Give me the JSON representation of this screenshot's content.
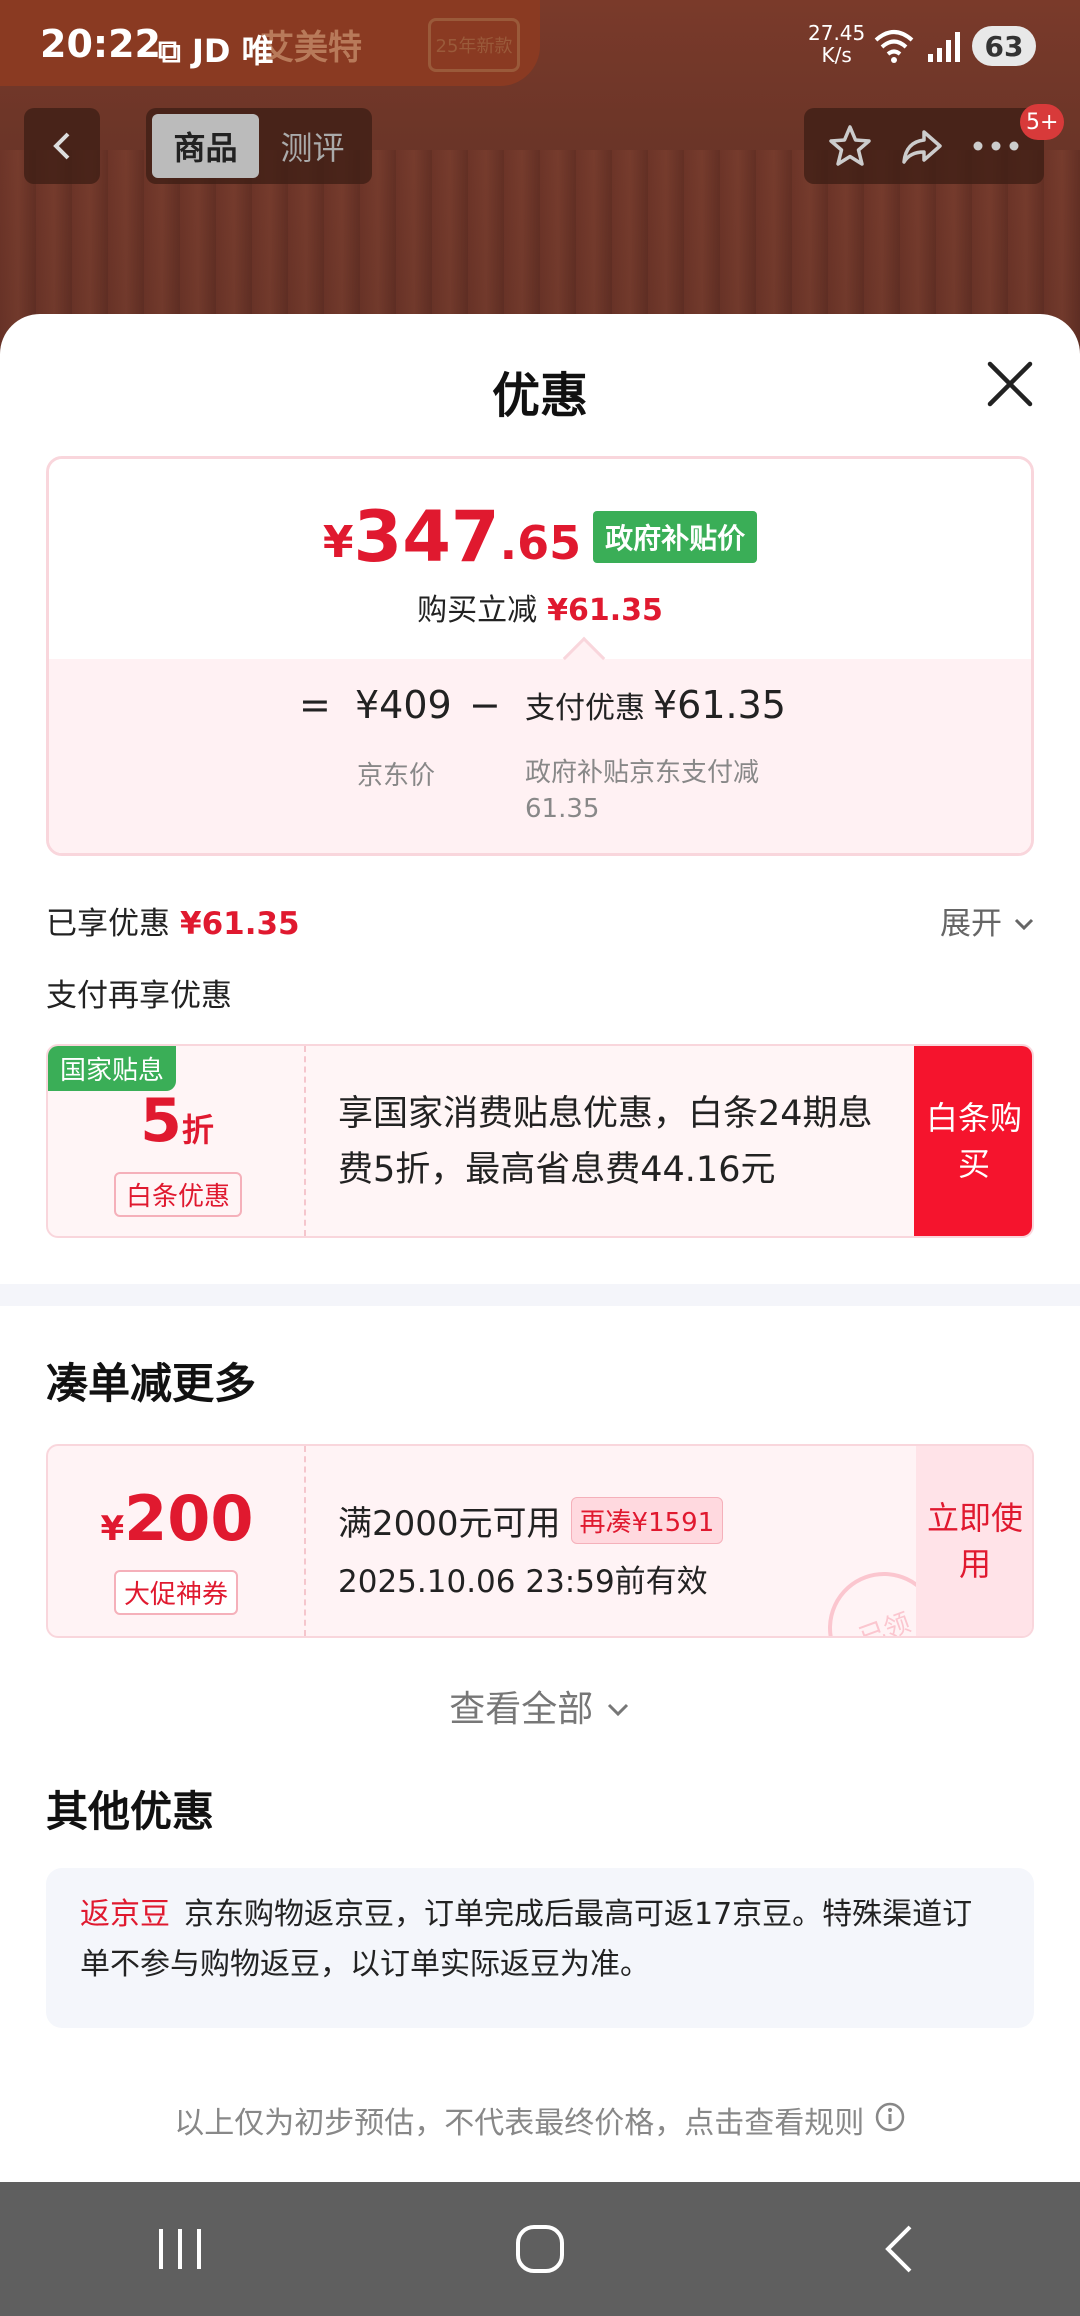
{
  "status_bar": {
    "time": "20:22",
    "extra": "JD 唯",
    "net_speed_value": "27.45",
    "net_speed_unit": "K/s",
    "battery": "63"
  },
  "background": {
    "banner_text": "艾美特",
    "banner_badge": "25年新款"
  },
  "nav": {
    "tabs": [
      {
        "label": "商品",
        "active": true
      },
      {
        "label": "测评",
        "active": false
      }
    ],
    "badge": "5+"
  },
  "sheet": {
    "title": "优惠",
    "price": {
      "symbol": "¥",
      "integer": "347",
      "decimal": ".65",
      "tag": "政府补贴价",
      "instant_label": "购买立减",
      "instant_value": "¥61.35"
    },
    "formula": {
      "equals": "=",
      "jd_price": "¥409",
      "minus": "−",
      "pay_label": "支付优惠",
      "pay_value": "¥61.35",
      "jd_price_caption": "京东价",
      "pay_caption": "政府补贴京东支付减61.35"
    },
    "enjoyed_label": "已享优惠",
    "enjoyed_value": "¥61.35",
    "expand_label": "展开",
    "pay_more_label": "支付再享优惠",
    "baitiao": {
      "corner_tag": "国家贴息",
      "discount_num": "5",
      "discount_unit": "折",
      "label": "白条优惠",
      "text": "享国家消费贴息优惠，白条24期息费5折，最高省息费44.16元",
      "button": "白条购买"
    },
    "section_more": "凑单减更多",
    "coupon": {
      "symbol": "¥",
      "amount": "200",
      "label": "大促神券",
      "condition": "满2000元可用",
      "tag": "再凑¥1591",
      "valid": "2025.10.06 23:59前有效",
      "button": "立即使用",
      "stamp": "已领"
    },
    "view_all": "查看全部",
    "section_other": "其他优惠",
    "other": {
      "tag": "返京豆",
      "text": "京东购物返京豆，订单完成后最高可返17京豆。特殊渠道订单不参与购物返豆，以订单实际返豆为准。"
    },
    "note": "以上仅为初步预估，不代表最终价格，点击查看规则"
  },
  "colors": {
    "accent_red": "#e0192f",
    "gov_green": "#3aae57",
    "nav_bar": "#5f5f5f"
  }
}
